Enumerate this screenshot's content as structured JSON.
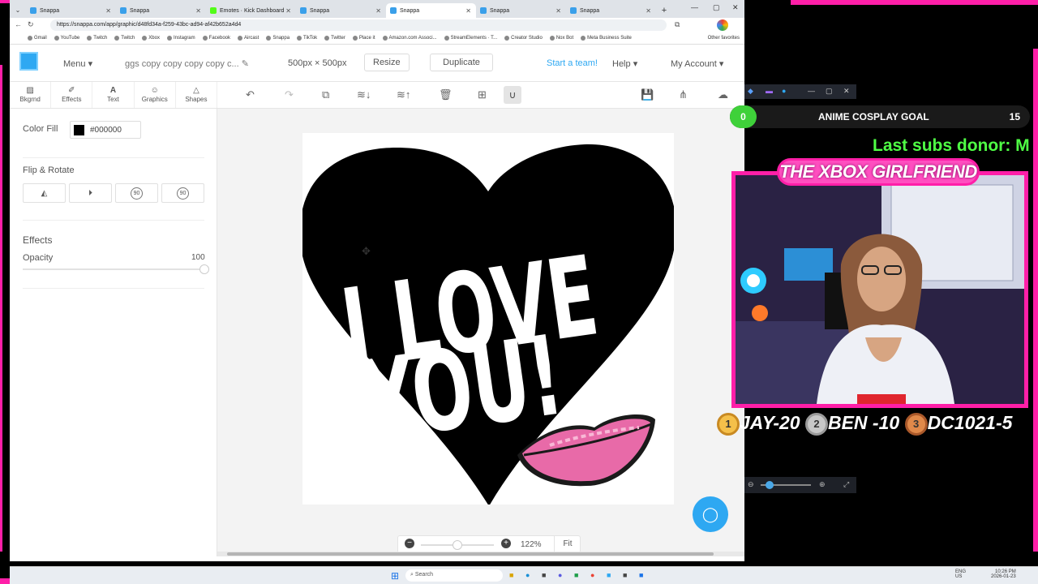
{
  "browser": {
    "tabs": [
      {
        "label": "Snappa",
        "favicon": "snappa"
      },
      {
        "label": "Snappa",
        "favicon": "snappa"
      },
      {
        "label": "Emotes · Kick Dashboard",
        "favicon": "kick"
      },
      {
        "label": "Snappa",
        "favicon": "snappa"
      },
      {
        "label": "Snappa",
        "favicon": "snappa",
        "active": true
      },
      {
        "label": "Snappa",
        "favicon": "snappa"
      },
      {
        "label": "Snappa",
        "favicon": "snappa"
      }
    ],
    "new_tab": "+",
    "url": "https://snappa.com/app/graphic/d48fd34a-f259-43bc-ad94-af42b652a4d4",
    "bookmarks": [
      "Gmail",
      "YouTube",
      "Twitch",
      "Twitch",
      "Xbox",
      "Instagram",
      "Facebook",
      "Aircast",
      "Snappa",
      "TikTok",
      "Twitter",
      "Place it",
      "Amazon.com Associ...",
      "StreamElements · T...",
      "Creator Studio",
      "Nox Bot",
      "Meta Business Suite"
    ],
    "other_bookmarks": "Other favorites"
  },
  "app": {
    "menu_label": "Menu",
    "design_name": "ggs copy copy copy copy c...",
    "dimensions": "500px × 500px",
    "resize_label": "Resize",
    "duplicate_label": "Duplicate",
    "team_link": "Start a team!",
    "help_label": "Help",
    "account_label": "My Account",
    "accent_color": "#2ea8f2"
  },
  "tools": [
    {
      "label": "Bkgrnd",
      "icon": "image-icon"
    },
    {
      "label": "Effects",
      "icon": "brush-icon"
    },
    {
      "label": "Text",
      "icon": "text-icon"
    },
    {
      "label": "Graphics",
      "icon": "smile-icon"
    },
    {
      "label": "Shapes",
      "icon": "triangle-icon"
    }
  ],
  "panel": {
    "color_fill_label": "Color Fill",
    "color_hex": "#000000",
    "flip_rotate_heading": "Flip & Rotate",
    "rotate_left": "90",
    "rotate_right": "90",
    "effects_heading": "Effects",
    "opacity_label": "Opacity",
    "opacity_value": "100"
  },
  "canvas": {
    "line1": "I LOVE",
    "line2": "YOU!",
    "heart_color": "#000000",
    "lips_color": "#e86aa8"
  },
  "zoom": {
    "value": "122%",
    "fit_label": "Fit",
    "level": 0.5
  },
  "overlay": {
    "goal_count": "0",
    "goal_title": "ANIME COSPLAY GOAL",
    "goal_target": "15",
    "marquee": "Last subs donor: M",
    "banner": "THE XBOX GIRLFRIEND",
    "leaders": [
      {
        "rank": "1",
        "text": "JAY-20"
      },
      {
        "rank": "2",
        "text": "BEN -10"
      },
      {
        "rank": "3",
        "text": "DC1021-5"
      }
    ]
  },
  "taskbar": {
    "search_label": "Search",
    "lang": "ENG",
    "lang_sub": "US",
    "time": "10:26 PM",
    "date": "2026-01-23"
  }
}
